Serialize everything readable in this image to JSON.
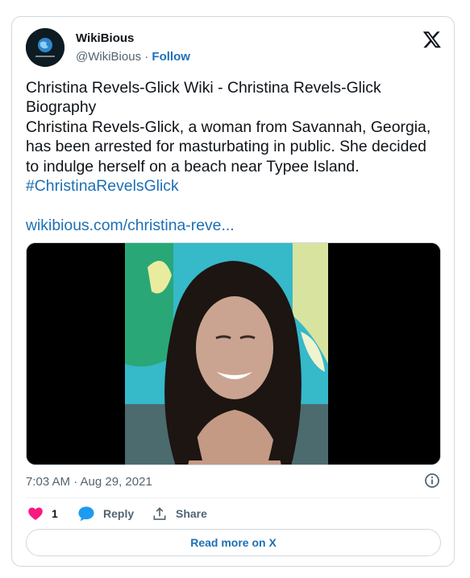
{
  "account": {
    "name": "WikiBious",
    "handle": "@WikiBious",
    "separator": "·",
    "follow_label": "Follow",
    "avatar_icon": "globe-logo-icon"
  },
  "tweet": {
    "lines": [
      "Christina Revels-Glick Wiki - Christina Revels-Glick",
      "Biography",
      "Christina Revels-Glick, a woman from Savannah, Georgia,",
      "has been arrested for masturbating in public. She decided",
      "to indulge herself on a beach near Typee Island."
    ],
    "hashtag": "#ChristinaRevelsGlick",
    "link": "wikibious.com/christina-reve..."
  },
  "timestamp": "7:03 AM · Aug 29, 2021",
  "actions": {
    "like_count": "1",
    "reply_label": "Reply",
    "share_label": "Share"
  },
  "read_more_label": "Read more on X",
  "colors": {
    "link": "#1d6fb5",
    "like": "#f91880",
    "reply": "#1d9bf0",
    "muted": "#536471",
    "border": "#cfd9de"
  }
}
